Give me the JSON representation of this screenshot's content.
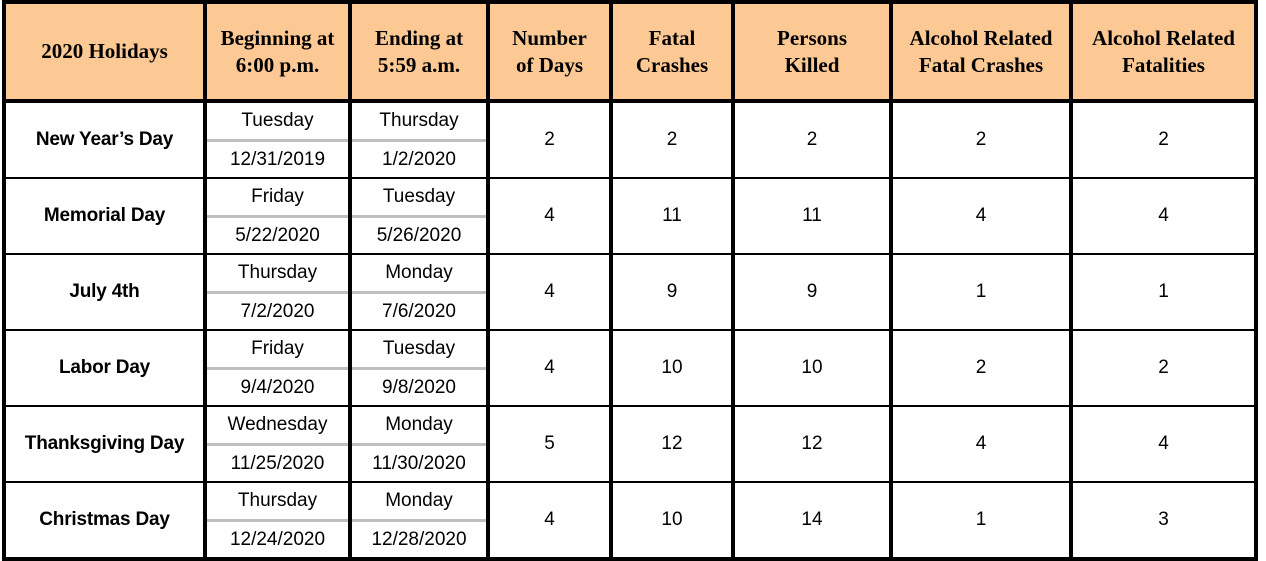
{
  "theme": {
    "header_bg": "#FCC894",
    "border_color": "#000000",
    "divider_color": "#BFBFBF",
    "text_color": "#000000",
    "page_bg": "#FFFFFF"
  },
  "table": {
    "columns": [
      {
        "key": "holiday",
        "line1": "2020 Holidays",
        "line2": ""
      },
      {
        "key": "begin",
        "line1": "Beginning at",
        "line2": "6:00 p.m."
      },
      {
        "key": "end",
        "line1": "Ending at",
        "line2": "5:59 a.m."
      },
      {
        "key": "days",
        "line1": "Number",
        "line2": "of  Days"
      },
      {
        "key": "crashes",
        "line1": "Fatal",
        "line2": "Crashes"
      },
      {
        "key": "killed",
        "line1": "Persons",
        "line2": "Killed"
      },
      {
        "key": "ar_crash",
        "line1": "Alcohol Related",
        "line2": "Fatal Crashes"
      },
      {
        "key": "ar_fatal",
        "line1": "Alcohol Related",
        "line2": "Fatalities"
      }
    ],
    "rows": [
      {
        "holiday": "New Year’s Day",
        "begin_dow": "Tuesday",
        "begin_date": "12/31/2019",
        "end_dow": "Thursday",
        "end_date": "1/2/2020",
        "days": "2",
        "fatal_crashes": "2",
        "persons_killed": "2",
        "alcohol_fatal_crashes": "2",
        "alcohol_fatalities": "2"
      },
      {
        "holiday": "Memorial Day",
        "begin_dow": "Friday",
        "begin_date": "5/22/2020",
        "end_dow": "Tuesday",
        "end_date": "5/26/2020",
        "days": "4",
        "fatal_crashes": "11",
        "persons_killed": "11",
        "alcohol_fatal_crashes": "4",
        "alcohol_fatalities": "4"
      },
      {
        "holiday": "July 4th",
        "begin_dow": "Thursday",
        "begin_date": "7/2/2020",
        "end_dow": "Monday",
        "end_date": "7/6/2020",
        "days": "4",
        "fatal_crashes": "9",
        "persons_killed": "9",
        "alcohol_fatal_crashes": "1",
        "alcohol_fatalities": "1"
      },
      {
        "holiday": "Labor Day",
        "begin_dow": "Friday",
        "begin_date": "9/4/2020",
        "end_dow": "Tuesday",
        "end_date": "9/8/2020",
        "days": "4",
        "fatal_crashes": "10",
        "persons_killed": "10",
        "alcohol_fatal_crashes": "2",
        "alcohol_fatalities": "2"
      },
      {
        "holiday": "Thanksgiving Day",
        "begin_dow": "Wednesday",
        "begin_date": "11/25/2020",
        "end_dow": "Monday",
        "end_date": "11/30/2020",
        "days": "5",
        "fatal_crashes": "12",
        "persons_killed": "12",
        "alcohol_fatal_crashes": "4",
        "alcohol_fatalities": "4"
      },
      {
        "holiday": "Christmas Day",
        "begin_dow": "Thursday",
        "begin_date": "12/24/2020",
        "end_dow": "Monday",
        "end_date": "12/28/2020",
        "days": "4",
        "fatal_crashes": "10",
        "persons_killed": "14",
        "alcohol_fatal_crashes": "1",
        "alcohol_fatalities": "3"
      }
    ]
  },
  "chart_data": {
    "type": "table",
    "title": "2020 Holidays",
    "columns": [
      "2020 Holidays",
      "Beginning at 6:00 p.m.",
      "Ending at 5:59 a.m.",
      "Number of Days",
      "Fatal Crashes",
      "Persons Killed",
      "Alcohol Related Fatal Crashes",
      "Alcohol Related Fatalities"
    ],
    "rows": [
      [
        "New Year’s Day",
        "Tuesday 12/31/2019",
        "Thursday 1/2/2020",
        2,
        2,
        2,
        2,
        2
      ],
      [
        "Memorial Day",
        "Friday 5/22/2020",
        "Tuesday 5/26/2020",
        4,
        11,
        11,
        4,
        4
      ],
      [
        "July 4th",
        "Thursday 7/2/2020",
        "Monday 7/6/2020",
        4,
        9,
        9,
        1,
        1
      ],
      [
        "Labor Day",
        "Friday 9/4/2020",
        "Tuesday 9/8/2020",
        4,
        10,
        10,
        2,
        2
      ],
      [
        "Thanksgiving Day",
        "Wednesday 11/25/2020",
        "Monday 11/30/2020",
        5,
        12,
        12,
        4,
        4
      ],
      [
        "Christmas Day",
        "Thursday 12/24/2020",
        "Monday 12/28/2020",
        4,
        10,
        14,
        1,
        3
      ]
    ]
  }
}
